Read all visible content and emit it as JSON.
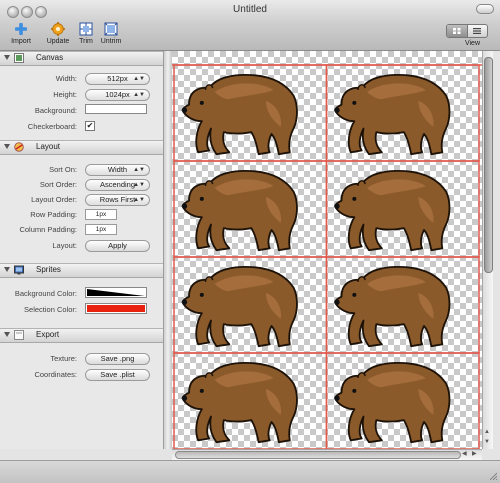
{
  "window": {
    "title": "Untitled"
  },
  "toolbar": {
    "import_label": "Import",
    "update_label": "Update",
    "trim_label": "Trim",
    "untrim_label": "Untrim",
    "view_label": "View"
  },
  "canvas_section": {
    "title": "Canvas",
    "width_label": "Width:",
    "width_value": "512px",
    "height_label": "Height:",
    "height_value": "1024px",
    "background_label": "Background:",
    "checkerboard_label": "Checkerboard:",
    "checkerboard_checked": true
  },
  "layout_section": {
    "title": "Layout",
    "sort_on_label": "Sort On:",
    "sort_on_value": "Width",
    "sort_order_label": "Sort Order:",
    "sort_order_value": "Ascending",
    "layout_order_label": "Layout Order:",
    "layout_order_value": "Rows First",
    "row_padding_label": "Row Padding:",
    "row_padding_value": "1px",
    "column_padding_label": "Column Padding:",
    "column_padding_value": "1px",
    "layout_label": "Layout:",
    "apply_label": "Apply"
  },
  "sprites_section": {
    "title": "Sprites",
    "background_color_label": "Background Color:",
    "selection_color_label": "Selection Color:",
    "selection_color": "#e8220f"
  },
  "export_section": {
    "title": "Export",
    "texture_label": "Texture:",
    "texture_button": "Save .png",
    "coordinates_label": "Coordinates:",
    "coordinates_button": "Save .plist"
  },
  "sprite_sheet": {
    "columns": 2,
    "rows": 4,
    "sprite_icon": "bear-icon",
    "grid_line_color": "#e05a4e",
    "bear_fill": "#8b5a2b",
    "bear_highlight": "#a9713e"
  }
}
